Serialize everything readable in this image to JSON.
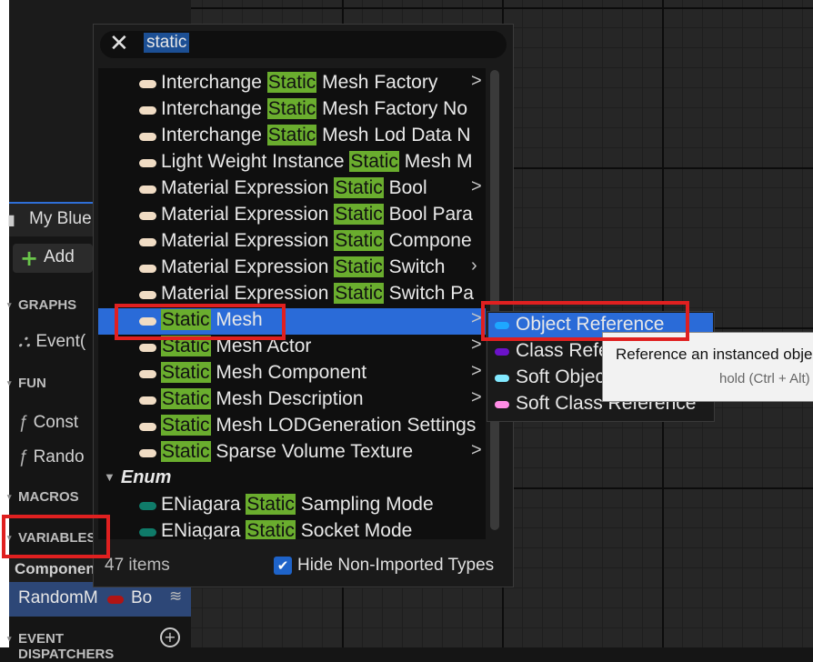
{
  "left_panel": {
    "tab_label": "My Blue",
    "add_label": "Add",
    "sections": {
      "graphs": "GRAPHS",
      "functions": "FUN",
      "macros": "MACROS",
      "variables": "VARIABLES",
      "event_dispatchers": "EVENT DISPATCHERS"
    },
    "graph_items": [
      "Event("
    ],
    "function_items": [
      "Const",
      "Rando"
    ],
    "components_header": "Componen",
    "variable_row": {
      "name": "RandomM",
      "type": "Bo",
      "type_color": "#b01414"
    }
  },
  "popup": {
    "search_value": "static",
    "highlight_color": "#6aad2e",
    "items": [
      {
        "before": "Interchange ",
        "hl": "Static",
        "after": " Mesh Factory",
        "chevron": ">",
        "pill": "#f0dcc4"
      },
      {
        "before": "Interchange ",
        "hl": "Static",
        "after": " Mesh Factory No",
        "chevron": "",
        "pill": "#f0dcc4"
      },
      {
        "before": "Interchange ",
        "hl": "Static",
        "after": " Mesh Lod Data N",
        "chevron": "",
        "pill": "#f0dcc4"
      },
      {
        "before": "Light Weight Instance ",
        "hl": "Static",
        "after": " Mesh M",
        "chevron": "",
        "pill": "#f0dcc4"
      },
      {
        "before": "Material Expression ",
        "hl": "Static",
        "after": " Bool",
        "chevron": ">",
        "pill": "#f0dcc4"
      },
      {
        "before": "Material Expression ",
        "hl": "Static",
        "after": " Bool Para",
        "chevron": "",
        "pill": "#f0dcc4"
      },
      {
        "before": "Material Expression ",
        "hl": "Static",
        "after": " Compone",
        "chevron": "",
        "pill": "#f0dcc4"
      },
      {
        "before": "Material Expression ",
        "hl": "Static",
        "after": " Switch",
        "chevron": "›",
        "pill": "#f0dcc4"
      },
      {
        "before": "Material Expression ",
        "hl": "Static",
        "after": " Switch Pa",
        "chevron": "",
        "pill": "#f0dcc4"
      },
      {
        "before": "",
        "hl": "Static",
        "after": " Mesh",
        "chevron": ">",
        "pill": "#f0dcc4",
        "selected": true
      },
      {
        "before": "",
        "hl": "Static",
        "after": " Mesh Actor",
        "chevron": ">",
        "pill": "#f0dcc4"
      },
      {
        "before": "",
        "hl": "Static",
        "after": " Mesh Component",
        "chevron": ">",
        "pill": "#f0dcc4"
      },
      {
        "before": "",
        "hl": "Static",
        "after": " Mesh Description",
        "chevron": ">",
        "pill": "#f0dcc4"
      },
      {
        "before": "",
        "hl": "Static",
        "after": " Mesh LODGeneration Settings",
        "chevron": "",
        "pill": "#f0dcc4"
      },
      {
        "before": "",
        "hl": "Static",
        "after": " Sparse Volume Texture",
        "chevron": ">",
        "pill": "#f0dcc4"
      }
    ],
    "enum_header": "Enum",
    "enum_items": [
      {
        "before": "ENiagara ",
        "hl": "Static",
        "after": " Sampling Mode",
        "pill": "#0f7b69"
      },
      {
        "before": "ENiagara ",
        "hl": "Static",
        "after": " Socket Mode",
        "pill": "#0f7b69"
      }
    ],
    "item_count": "47 items",
    "hide_non_imported_label": "Hide Non-Imported Types",
    "hide_non_imported_checked": true
  },
  "submenu": {
    "items": [
      {
        "label": "Object Reference",
        "pill": "#1ea7ff",
        "selected": true
      },
      {
        "label": "Class Reference",
        "pill": "#6b12c9"
      },
      {
        "label": "Soft Object Reference",
        "pill": "#82e9ff"
      },
      {
        "label": "Soft Class Reference",
        "pill": "#ff8ce6"
      }
    ]
  },
  "tooltip": {
    "line1": "Reference an instanced obje",
    "line2": "hold (Ctrl + Alt)"
  },
  "colors": {
    "selection_blue": "#2a6bd8",
    "highlight_red": "#e02020"
  }
}
